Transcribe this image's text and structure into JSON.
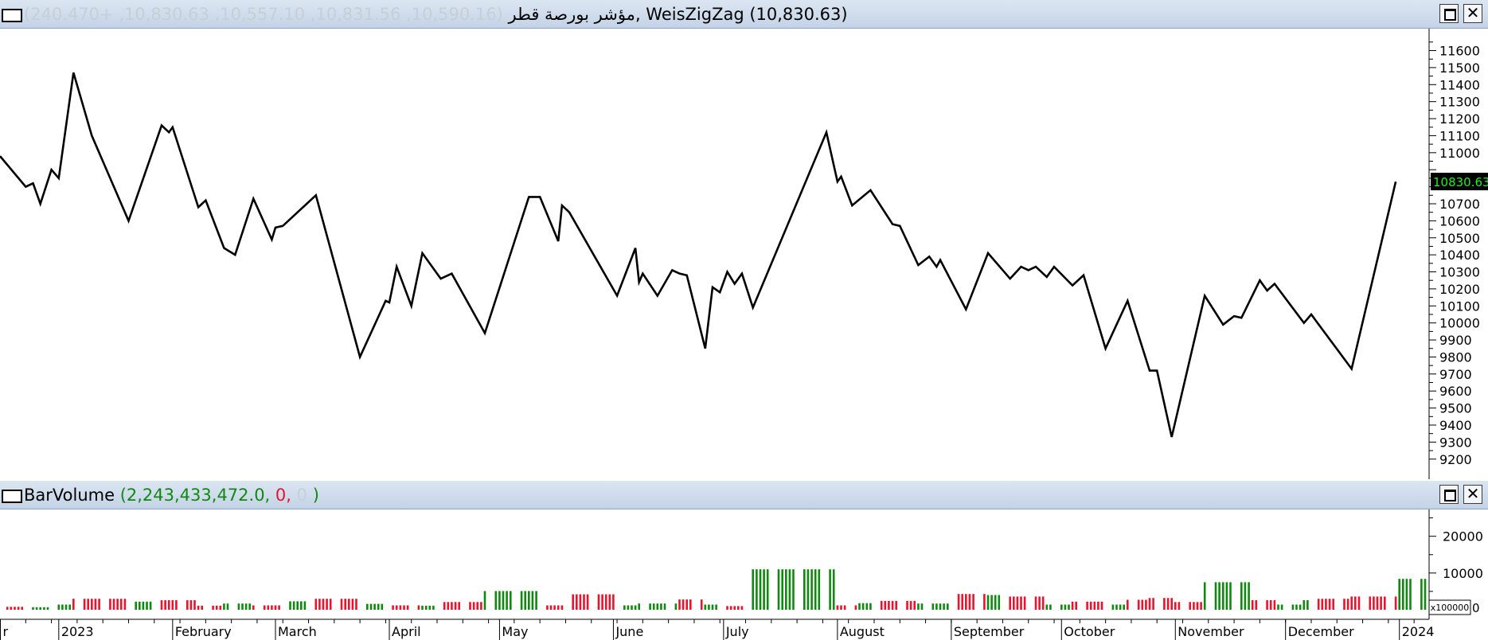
{
  "price_panel": {
    "title_symbol": "مؤشر بورصة قطر",
    "title_ohlc": " (10,590.16, 10,831.56, 10,557.10, 10,830.63, +240.470)",
    "title_indicator": ", WeisZigZag (10,830.63)",
    "current_price_label": "10830.63",
    "maximize_label": "",
    "close_label": "✕"
  },
  "volume_panel": {
    "title_name": "BarVolume",
    "title_open": " (",
    "title_value1": "2,243,433,472.0,",
    "title_value2": " 0,",
    "title_value3": " 0",
    "title_close": " )",
    "multiplier_label": "x100000",
    "multiplier_zero": "0",
    "maximize_label": "",
    "close_label": "✕"
  },
  "colors": {
    "up": "#118811",
    "down": "#e8132c",
    "line": "#000000",
    "price_tag_bg": "#000000",
    "price_tag_fg": "#22ee22"
  },
  "chart_data": [
    {
      "type": "line",
      "title": "مؤشر بورصة قطر, WeisZigZag",
      "ylim": [
        9110,
        11710
      ],
      "y_ticks": [
        9200,
        9300,
        9400,
        9500,
        9600,
        9700,
        9800,
        9900,
        10000,
        10100,
        10200,
        10300,
        10400,
        10500,
        10600,
        10700,
        10800,
        10900,
        11000,
        11100,
        11200,
        11300,
        11400,
        11500,
        11600
      ],
      "y_tick_labels": [
        "9200",
        "9300",
        "9400",
        "9500",
        "9600",
        "9700",
        "9800",
        "9900",
        "10000",
        "10100",
        "10200",
        "10300",
        "10400",
        "10500",
        "10600",
        "10700",
        "",
        "",
        "11000",
        "11100",
        "11200",
        "11300",
        "11400",
        "11500",
        "11600"
      ],
      "x_start": "2022-12-16",
      "x_end": "2024-01-08",
      "last_value": 10830.63,
      "series": [
        {
          "values": [
            [
              "2022-12-16",
              10980
            ],
            [
              "2022-12-23",
              10800
            ],
            [
              "2022-12-25",
              10820
            ],
            [
              "2022-12-27",
              10700
            ],
            [
              "2022-12-30",
              10900
            ],
            [
              "2023-01-01",
              10850
            ],
            [
              "2023-01-05",
              11470
            ],
            [
              "2023-01-10",
              11100
            ],
            [
              "2023-01-20",
              10600
            ],
            [
              "2023-01-29",
              11160
            ],
            [
              "2023-01-31",
              11120
            ],
            [
              "2023-02-01",
              11150
            ],
            [
              "2023-02-08",
              10680
            ],
            [
              "2023-02-10",
              10720
            ],
            [
              "2023-02-15",
              10440
            ],
            [
              "2023-02-18",
              10400
            ],
            [
              "2023-02-23",
              10730
            ],
            [
              "2023-02-28",
              10490
            ],
            [
              "2023-03-01",
              10560
            ],
            [
              "2023-03-03",
              10570
            ],
            [
              "2023-03-12",
              10750
            ],
            [
              "2023-03-24",
              9800
            ],
            [
              "2023-03-31",
              10130
            ],
            [
              "2023-04-01",
              10120
            ],
            [
              "2023-04-03",
              10330
            ],
            [
              "2023-04-07",
              10100
            ],
            [
              "2023-04-10",
              10410
            ],
            [
              "2023-04-15",
              10260
            ],
            [
              "2023-04-18",
              10290
            ],
            [
              "2023-04-27",
              9940
            ],
            [
              "2023-05-09",
              10740
            ],
            [
              "2023-05-12",
              10740
            ],
            [
              "2023-05-17",
              10480
            ],
            [
              "2023-05-18",
              10690
            ],
            [
              "2023-05-20",
              10650
            ],
            [
              "2023-06-02",
              10160
            ],
            [
              "2023-06-07",
              10440
            ],
            [
              "2023-06-08",
              10240
            ],
            [
              "2023-06-09",
              10290
            ],
            [
              "2023-06-13",
              10160
            ],
            [
              "2023-06-17",
              10310
            ],
            [
              "2023-06-19",
              10290
            ],
            [
              "2023-06-21",
              10280
            ],
            [
              "2023-06-26",
              9850
            ],
            [
              "2023-06-28",
              10210
            ],
            [
              "2023-06-30",
              10180
            ],
            [
              "2023-07-02",
              10300
            ],
            [
              "2023-07-04",
              10230
            ],
            [
              "2023-07-06",
              10290
            ],
            [
              "2023-07-09",
              10090
            ],
            [
              "2023-07-29",
              11120
            ],
            [
              "2023-08-01",
              10830
            ],
            [
              "2023-08-02",
              10860
            ],
            [
              "2023-08-05",
              10690
            ],
            [
              "2023-08-10",
              10780
            ],
            [
              "2023-08-16",
              10580
            ],
            [
              "2023-08-18",
              10570
            ],
            [
              "2023-08-23",
              10340
            ],
            [
              "2023-08-26",
              10390
            ],
            [
              "2023-08-28",
              10330
            ],
            [
              "2023-08-29",
              10370
            ],
            [
              "2023-09-05",
              10080
            ],
            [
              "2023-09-11",
              10410
            ],
            [
              "2023-09-17",
              10260
            ],
            [
              "2023-09-20",
              10330
            ],
            [
              "2023-09-22",
              10310
            ],
            [
              "2023-09-24",
              10330
            ],
            [
              "2023-09-27",
              10270
            ],
            [
              "2023-09-29",
              10330
            ],
            [
              "2023-10-04",
              10220
            ],
            [
              "2023-10-07",
              10280
            ],
            [
              "2023-10-13",
              9850
            ],
            [
              "2023-10-19",
              10130
            ],
            [
              "2023-10-25",
              9720
            ],
            [
              "2023-10-27",
              9720
            ],
            [
              "2023-10-31",
              9330
            ],
            [
              "2023-11-09",
              10160
            ],
            [
              "2023-11-14",
              9990
            ],
            [
              "2023-11-17",
              10040
            ],
            [
              "2023-11-19",
              10030
            ],
            [
              "2023-11-24",
              10250
            ],
            [
              "2023-11-26",
              10190
            ],
            [
              "2023-11-28",
              10230
            ],
            [
              "2023-12-06",
              10000
            ],
            [
              "2023-12-08",
              10050
            ],
            [
              "2023-12-19",
              9730
            ],
            [
              "2023-12-31",
              10830
            ]
          ]
        }
      ]
    },
    {
      "type": "bar",
      "title": "BarVolume",
      "ylim": [
        0,
        26000
      ],
      "y_ticks": [
        10000,
        20000
      ],
      "y_tick_labels": [
        "10000",
        "20000"
      ],
      "y_unit_multiplier": "x100000",
      "x_start": "2022-12-16",
      "x_end": "2024-01-08",
      "x_ticks": [
        {
          "date": "2022-12-16",
          "label": "r"
        },
        {
          "date": "2023-01-01",
          "label": "2023"
        },
        {
          "date": "2023-02-01",
          "label": "February"
        },
        {
          "date": "2023-03-01",
          "label": "March"
        },
        {
          "date": "2023-04-01",
          "label": "April"
        },
        {
          "date": "2023-05-01",
          "label": "May"
        },
        {
          "date": "2023-06-01",
          "label": "June"
        },
        {
          "date": "2023-07-01",
          "label": "July"
        },
        {
          "date": "2023-08-01",
          "label": "August"
        },
        {
          "date": "2023-09-01",
          "label": "September"
        },
        {
          "date": "2023-10-01",
          "label": "October"
        },
        {
          "date": "2023-11-01",
          "label": "November"
        },
        {
          "date": "2023-12-01",
          "label": "December"
        },
        {
          "date": "2024-01-01",
          "label": "2024"
        }
      ],
      "segments": [
        {
          "start": "2022-12-16",
          "end": "2022-12-23",
          "value": 800,
          "direction": "down"
        },
        {
          "start": "2022-12-24",
          "end": "2022-12-30",
          "value": 700,
          "direction": "up"
        },
        {
          "start": "2023-01-01",
          "end": "2023-01-04",
          "value": 1400,
          "direction": "up"
        },
        {
          "start": "2023-01-05",
          "end": "2023-01-19",
          "value": 3000,
          "direction": "down"
        },
        {
          "start": "2023-01-20",
          "end": "2023-01-28",
          "value": 2200,
          "direction": "up"
        },
        {
          "start": "2023-01-29",
          "end": "2023-02-07",
          "value": 2600,
          "direction": "down"
        },
        {
          "start": "2023-02-08",
          "end": "2023-02-14",
          "value": 1100,
          "direction": "down"
        },
        {
          "start": "2023-02-15",
          "end": "2023-02-22",
          "value": 1700,
          "direction": "up"
        },
        {
          "start": "2023-02-23",
          "end": "2023-03-02",
          "value": 1200,
          "direction": "down"
        },
        {
          "start": "2023-03-03",
          "end": "2023-03-11",
          "value": 2300,
          "direction": "up"
        },
        {
          "start": "2023-03-12",
          "end": "2023-03-23",
          "value": 3000,
          "direction": "down"
        },
        {
          "start": "2023-03-24",
          "end": "2023-03-30",
          "value": 1600,
          "direction": "up"
        },
        {
          "start": "2023-03-31",
          "end": "2023-04-09",
          "value": 1200,
          "direction": "down"
        },
        {
          "start": "2023-04-10",
          "end": "2023-04-14",
          "value": 1100,
          "direction": "up"
        },
        {
          "start": "2023-04-15",
          "end": "2023-04-26",
          "value": 2100,
          "direction": "down"
        },
        {
          "start": "2023-04-27",
          "end": "2023-05-11",
          "value": 5100,
          "direction": "up"
        },
        {
          "start": "2023-05-12",
          "end": "2023-05-19",
          "value": 1200,
          "direction": "down"
        },
        {
          "start": "2023-05-20",
          "end": "2023-06-01",
          "value": 4200,
          "direction": "down"
        },
        {
          "start": "2023-06-02",
          "end": "2023-06-07",
          "value": 1200,
          "direction": "up"
        },
        {
          "start": "2023-06-08",
          "end": "2023-06-18",
          "value": 1700,
          "direction": "up"
        },
        {
          "start": "2023-06-19",
          "end": "2023-06-25",
          "value": 2800,
          "direction": "down"
        },
        {
          "start": "2023-06-26",
          "end": "2023-06-30",
          "value": 1400,
          "direction": "up"
        },
        {
          "start": "2023-07-01",
          "end": "2023-07-08",
          "value": 1000,
          "direction": "down"
        },
        {
          "start": "2023-07-09",
          "end": "2023-07-31",
          "value": 11000,
          "direction": "up"
        },
        {
          "start": "2023-08-01",
          "end": "2023-08-06",
          "value": 1200,
          "direction": "down"
        },
        {
          "start": "2023-08-07",
          "end": "2023-08-12",
          "value": 1800,
          "direction": "up"
        },
        {
          "start": "2023-08-13",
          "end": "2023-08-22",
          "value": 2400,
          "direction": "down"
        },
        {
          "start": "2023-08-23",
          "end": "2023-08-31",
          "value": 1700,
          "direction": "up"
        },
        {
          "start": "2023-09-01",
          "end": "2023-09-10",
          "value": 4300,
          "direction": "down"
        },
        {
          "start": "2023-09-11",
          "end": "2023-09-16",
          "value": 4000,
          "direction": "up"
        },
        {
          "start": "2023-09-17",
          "end": "2023-09-26",
          "value": 3600,
          "direction": "down"
        },
        {
          "start": "2023-09-27",
          "end": "2023-10-03",
          "value": 1400,
          "direction": "up"
        },
        {
          "start": "2023-10-04",
          "end": "2023-10-12",
          "value": 2200,
          "direction": "down"
        },
        {
          "start": "2023-10-13",
          "end": "2023-10-18",
          "value": 1400,
          "direction": "up"
        },
        {
          "start": "2023-10-19",
          "end": "2023-10-24",
          "value": 2700,
          "direction": "down"
        },
        {
          "start": "2023-10-25",
          "end": "2023-10-31",
          "value": 3200,
          "direction": "down"
        },
        {
          "start": "2023-11-01",
          "end": "2023-11-08",
          "value": 2100,
          "direction": "down"
        },
        {
          "start": "2023-11-09",
          "end": "2023-11-21",
          "value": 7500,
          "direction": "up"
        },
        {
          "start": "2023-11-22",
          "end": "2023-11-28",
          "value": 2600,
          "direction": "down"
        },
        {
          "start": "2023-11-29",
          "end": "2023-12-05",
          "value": 1400,
          "direction": "up"
        },
        {
          "start": "2023-12-06",
          "end": "2023-12-09",
          "value": 2600,
          "direction": "up"
        },
        {
          "start": "2023-12-10",
          "end": "2023-12-18",
          "value": 3000,
          "direction": "down"
        },
        {
          "start": "2023-12-19",
          "end": "2023-12-31",
          "value": 3600,
          "direction": "down"
        },
        {
          "start": "2024-01-01",
          "end": "2024-01-08",
          "value": 8400,
          "direction": "up"
        }
      ]
    }
  ]
}
